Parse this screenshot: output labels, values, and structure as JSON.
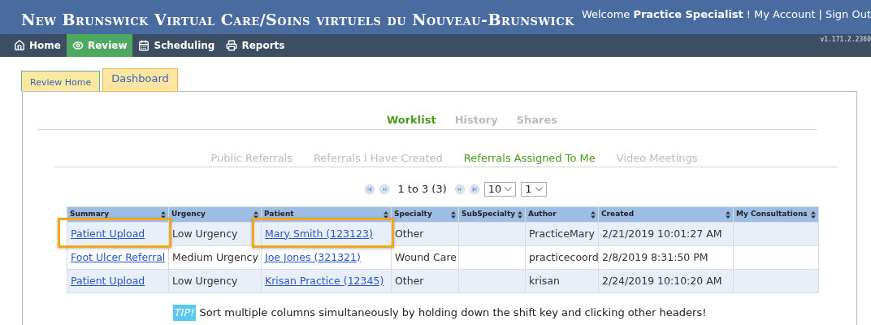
{
  "header": {
    "title": "New Brunswick Virtual Care/Soins virtuels du Nouveau-Brunswick",
    "welcome": "Welcome",
    "user": "Practice Specialist",
    "separator_text": "!",
    "account_link": "My Account",
    "divider": "|",
    "signout_link": "Sign Out",
    "version": "v1.171.2.2360"
  },
  "nav": [
    {
      "label": "Home",
      "selected": false
    },
    {
      "label": "Review",
      "selected": true
    },
    {
      "label": "Scheduling",
      "selected": false
    },
    {
      "label": "Reports",
      "selected": false
    }
  ],
  "page_tabs": [
    {
      "label": "Review Home",
      "selected": false
    },
    {
      "label": "Dashboard",
      "selected": true
    }
  ],
  "view_tabs": [
    {
      "label": "Worklist",
      "selected": true
    },
    {
      "label": "History",
      "selected": false
    },
    {
      "label": "Shares",
      "selected": false
    }
  ],
  "list_tabs": [
    {
      "label": "Public Referrals",
      "selected": false
    },
    {
      "label": "Referrals I Have Created",
      "selected": false
    },
    {
      "label": "Referrals Assigned To Me",
      "selected": true
    },
    {
      "label": "Video Meetings",
      "selected": false
    }
  ],
  "pager": {
    "range": "1 to 3 (3)",
    "page_size": "10",
    "page": "1"
  },
  "table": {
    "columns": [
      "Summary",
      "Urgency",
      "Patient",
      "Specialty",
      "SubSpecialty",
      "Author",
      "Created",
      "My Consultations"
    ],
    "rows": [
      [
        {
          "kind": "link",
          "text": "Patient Upload",
          "highlighted": true
        },
        {
          "kind": "text",
          "text": "Low Urgency",
          "highlighted": false
        },
        {
          "kind": "link",
          "text": "Mary Smith (123123)",
          "highlighted": true
        },
        {
          "kind": "text",
          "text": "Other",
          "highlighted": false
        },
        {
          "kind": "empty",
          "highlighted": false
        },
        {
          "kind": "text",
          "text": "PracticeMary",
          "highlighted": false
        },
        {
          "kind": "text",
          "text": "2/21/2019 10:01:27 AM",
          "highlighted": false
        },
        {
          "kind": "empty",
          "highlighted": false
        }
      ],
      [
        {
          "kind": "link",
          "text": "Foot Ulcer Referral",
          "highlighted": false
        },
        {
          "kind": "text",
          "text": "Medium Urgency",
          "highlighted": false
        },
        {
          "kind": "link",
          "text": "Joe Jones (321321)",
          "highlighted": false
        },
        {
          "kind": "text",
          "text": "Wound Care",
          "highlighted": false
        },
        {
          "kind": "empty",
          "highlighted": false
        },
        {
          "kind": "text",
          "text": "practicecoord",
          "highlighted": false
        },
        {
          "kind": "text",
          "text": "2/8/2019 8:31:50 PM",
          "highlighted": false
        },
        {
          "kind": "empty",
          "highlighted": false
        }
      ],
      [
        {
          "kind": "link",
          "text": "Patient Upload",
          "highlighted": false
        },
        {
          "kind": "text",
          "text": "Low Urgency",
          "highlighted": false
        },
        {
          "kind": "link",
          "text": "Krisan Practice (12345)",
          "highlighted": false
        },
        {
          "kind": "text",
          "text": "Other",
          "highlighted": false
        },
        {
          "kind": "empty",
          "highlighted": false
        },
        {
          "kind": "text",
          "text": "krisan",
          "highlighted": false
        },
        {
          "kind": "text",
          "text": "2/24/2019 10:10:20 AM",
          "highlighted": false
        },
        {
          "kind": "empty",
          "highlighted": false
        }
      ]
    ]
  },
  "tip": {
    "badge": "TIP!",
    "text": "Sort multiple columns simultaneously by holding down the shift key and clicking other headers!"
  }
}
